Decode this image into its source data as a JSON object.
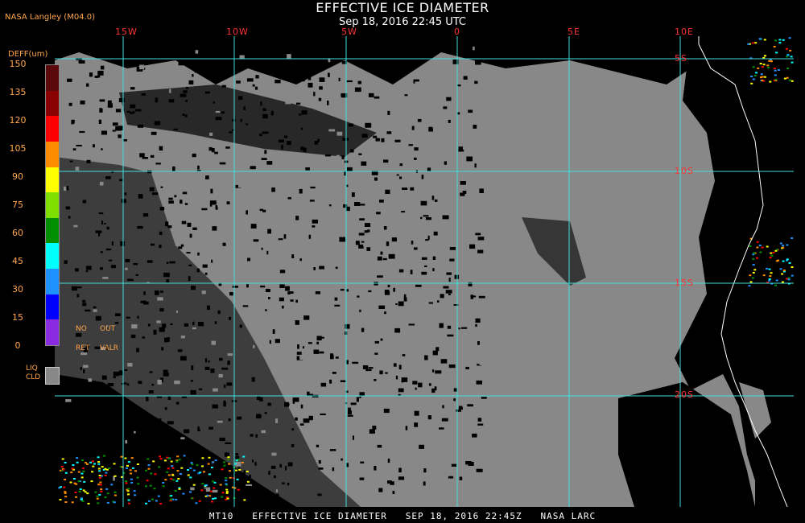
{
  "header": {
    "title": "EFFECTIVE ICE DIAMETER",
    "subtitle": "Sep 18, 2016 22:45 UTC",
    "credit": "NASA Langley (M04.0)"
  },
  "legend": {
    "title": "DEFF(um)",
    "ticks": [
      "150",
      "135",
      "120",
      "105",
      "90",
      "75",
      "60",
      "45",
      "30",
      "15",
      "0"
    ],
    "colors": [
      "#5a0a0a",
      "#8b0000",
      "#ff0000",
      "#ff8c00",
      "#ffff00",
      "#7fe000",
      "#008f00",
      "#00ffff",
      "#1e90ff",
      "#0000ff",
      "#8a2be2"
    ],
    "no_ret": [
      "NO",
      "RET"
    ],
    "out_valr": [
      "OUT",
      "VALR"
    ],
    "liq_cld": [
      "LIQ",
      "CLD"
    ]
  },
  "grid": {
    "lon_labels": [
      "15W",
      "10W",
      "5W",
      "0",
      "5E",
      "10E"
    ],
    "lat_labels": [
      "5S",
      "10S",
      "15S",
      "20S"
    ]
  },
  "colors": {
    "clear": "#000000",
    "liquid_cloud": "#888888",
    "grid": "#40e0e0",
    "coast": "#ffffff"
  },
  "footer": "MT10   EFFECTIVE ICE DIAMETER   SEP 18, 2016 22:45Z   NASA LARC"
}
